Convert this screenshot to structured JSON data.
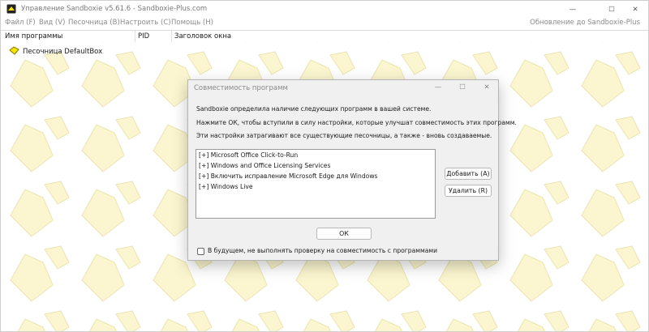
{
  "window": {
    "title": "Управление Sandboxie v5.61.6 - Sandboxie-Plus.com",
    "minimize_glyph": "—",
    "maximize_glyph": "☐",
    "close_glyph": "✕",
    "icon": "sandboxie-app-icon"
  },
  "menu": {
    "items": [
      "Файл (F)",
      "Вид (V)",
      "Песочница (B)",
      "Настроить (C)",
      "Помощь (H)"
    ],
    "update_link": "Обновление до Sandboxie-Plus"
  },
  "table": {
    "columns": [
      "Имя программы",
      "PID",
      "Заголовок окна"
    ],
    "rows": [
      {
        "label": "Песочница DefaultBox",
        "icon": "sandbox-icon"
      }
    ]
  },
  "dialog": {
    "title": "Совместимость программ",
    "minimize_glyph": "—",
    "maximize_glyph": "☐",
    "close_glyph": "✕",
    "line1": "Sandboxie определила наличие следующих программ в вашей системе.",
    "line2": "Нажмите ОК, чтобы вступили в силу настройки, которые улучшат совместимость этих программ.",
    "line3": "Эти настройки затрагивают все существующие песочницы, а также - вновь создаваемые.",
    "list": [
      "[+]  Microsoft Office Click-to-Run",
      "[+]  Windows and Office Licensing Services",
      "[+]  Включить исправление Microsoft Edge для Windows",
      "[+]  Windows Live"
    ],
    "add_label": "Добавить (А)",
    "remove_label": "Удалить (R)",
    "ok_label": "ОК",
    "checkbox_label": "В будущем, не выполнять проверку на совместимость с программами",
    "checkbox_checked": false
  },
  "colors": {
    "watermark_fill": "#fbf6cf",
    "watermark_stroke": "#ece4b0",
    "sandbox_yellow": "#f5e300"
  }
}
